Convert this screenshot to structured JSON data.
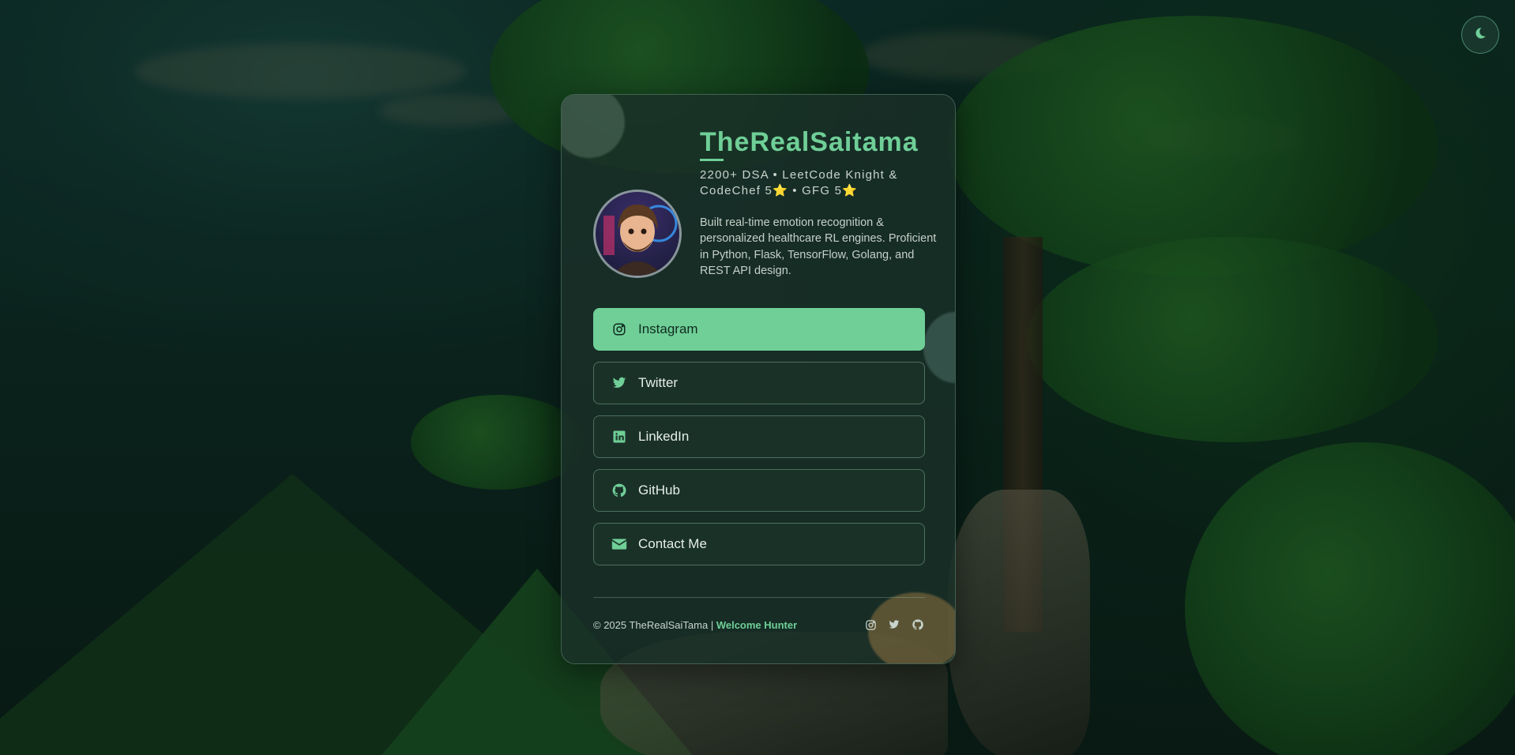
{
  "profile": {
    "name": "TheRealSaitama",
    "tagline": "2200+ DSA • LeetCode Knight & CodeChef 5⭐ • GFG 5⭐",
    "bio": "Built real-time emotion recognition & personalized healthcare RL engines. Proficient in Python, Flask, TensorFlow, Golang, and REST API design."
  },
  "links": [
    {
      "label": "Instagram",
      "icon": "instagram-icon",
      "active": true
    },
    {
      "label": "Twitter",
      "icon": "twitter-icon",
      "active": false
    },
    {
      "label": "LinkedIn",
      "icon": "linkedin-icon",
      "active": false
    },
    {
      "label": "GitHub",
      "icon": "github-icon",
      "active": false
    },
    {
      "label": "Contact Me",
      "icon": "envelope-icon",
      "active": false
    }
  ],
  "footer": {
    "copyright": "© 2025 TheRealSaiTama |",
    "welcome": "Welcome Hunter",
    "icons": [
      "instagram-icon",
      "twitter-icon",
      "github-icon"
    ]
  },
  "theme_toggle": {
    "icon": "moon-icon"
  },
  "colors": {
    "accent": "#6fcf97",
    "card": "#1a3028",
    "text": "#e6eee9"
  }
}
